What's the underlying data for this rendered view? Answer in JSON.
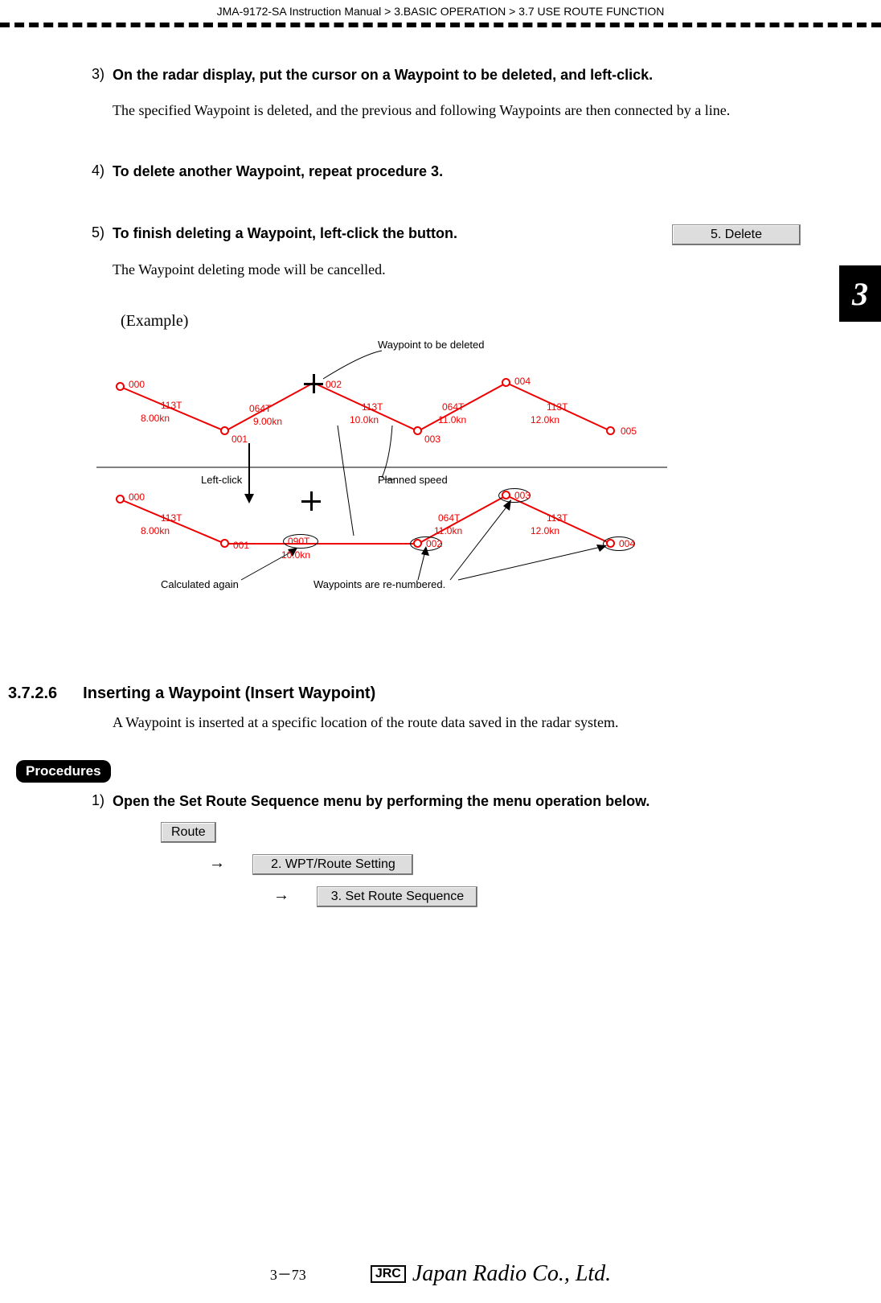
{
  "header": {
    "doc_id": "JMA-9172-SA Instruction Manual",
    "crumb1": "3.BASIC OPERATION",
    "crumb2": "3.7  USE ROUTE FUNCTION"
  },
  "side_tab": "3",
  "steps": {
    "s3": {
      "num": "3)",
      "title": "On the radar display, put the cursor on a Waypoint to be deleted, and left-click.",
      "body": "The specified Waypoint is deleted, and the previous and following Waypoints are then connected by a line."
    },
    "s4": {
      "num": "4)",
      "title": "To delete another Waypoint, repeat procedure 3."
    },
    "s5": {
      "num": "5)",
      "title_a": "To finish deleting a Waypoint, left-click the",
      "title_b": "button.",
      "btn": "5. Delete",
      "body": "The Waypoint deleting mode will be cancelled."
    }
  },
  "example_label": "(Example)",
  "diagram": {
    "top": {
      "wp000": "000",
      "wp001": "001",
      "wp002": "002",
      "wp003": "003",
      "wp004": "004",
      "wp005": "005",
      "c1": "113T",
      "s1": "8.00kn",
      "c2": "064T",
      "s2": "9.00kn",
      "c3": "113T",
      "s3": "10.0kn",
      "c4": "064T",
      "s4": "11.0kn",
      "c5": "113T",
      "s5": "12.0kn",
      "note_delete": "Waypoint to be deleted"
    },
    "mid": {
      "leftclick": "Left-click",
      "planned": "Planned speed"
    },
    "bottom": {
      "wp000": "000",
      "wp001": "001",
      "wp002": "002",
      "wp003": "003",
      "wp004": "004",
      "c1": "113T",
      "s1": "8.00kn",
      "c2": "090T",
      "s2": "10.0kn",
      "c3": "064T",
      "s3": "11.0kn",
      "c4": "113T",
      "s4": "12.0kn",
      "note_calc": "Calculated again",
      "note_renum": "Waypoints are re-numbered."
    }
  },
  "section": {
    "num": "3.7.2.6",
    "title": "Inserting a Waypoint (Insert Waypoint)",
    "body": "A Waypoint is inserted at a specific location of the route data saved in the radar system."
  },
  "procedures_label": "Procedures",
  "proc1": {
    "num": "1)",
    "title": "Open the Set Route Sequence menu by performing the menu operation below.",
    "menu": {
      "route": "Route",
      "arrow": "→",
      "m2": "2. WPT/Route Setting",
      "m3": "3. Set Route Sequence"
    }
  },
  "footer": {
    "page": "3－73",
    "jrc": "JRC",
    "company": "Japan Radio Co., Ltd."
  }
}
